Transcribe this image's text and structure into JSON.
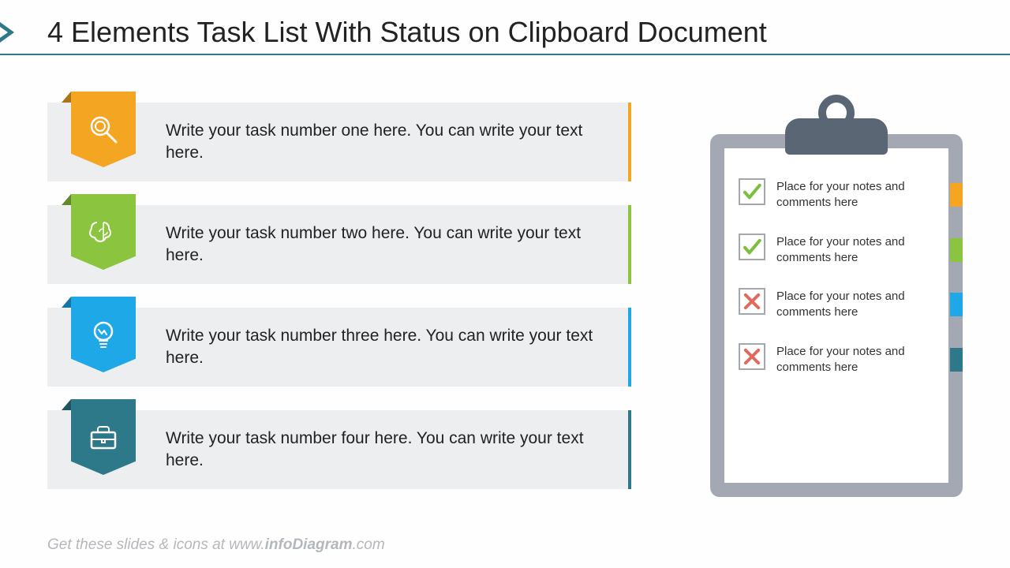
{
  "title": "4 Elements Task List With Status on Clipboard Document",
  "colors": {
    "orange": "#f4a521",
    "green": "#8bc53f",
    "blue": "#1fa8e8",
    "teal": "#2d7989",
    "checkGreen": "#7bbf3d",
    "crossRed": "#e26a5c",
    "gray": "#eceeef",
    "clip": "#5b6675",
    "board": "#a3a8b3"
  },
  "tasks": [
    {
      "icon": "magnifier-icon",
      "color": "orange",
      "text": "Write your task number one here. You can write your text here."
    },
    {
      "icon": "brain-icon",
      "color": "green",
      "text": "Write your task number two here. You can write your text here."
    },
    {
      "icon": "bulb-icon",
      "color": "blue",
      "text": "Write your task number three here. You can write your text here."
    },
    {
      "icon": "briefcase-icon",
      "color": "teal",
      "text": "Write your task number four here. You can write your text here."
    }
  ],
  "notes": [
    {
      "status": "check",
      "color": "orange",
      "text": "Place for your notes and comments  here"
    },
    {
      "status": "check",
      "color": "green",
      "text": "Place for your notes and comments  here"
    },
    {
      "status": "cross",
      "color": "blue",
      "text": "Place for your notes and comments  here"
    },
    {
      "status": "cross",
      "color": "teal",
      "text": "Place for your notes and comments  here"
    }
  ],
  "footer_prefix": "Get these slides & icons at www.",
  "footer_bold": "infoDiagram",
  "footer_suffix": ".com"
}
